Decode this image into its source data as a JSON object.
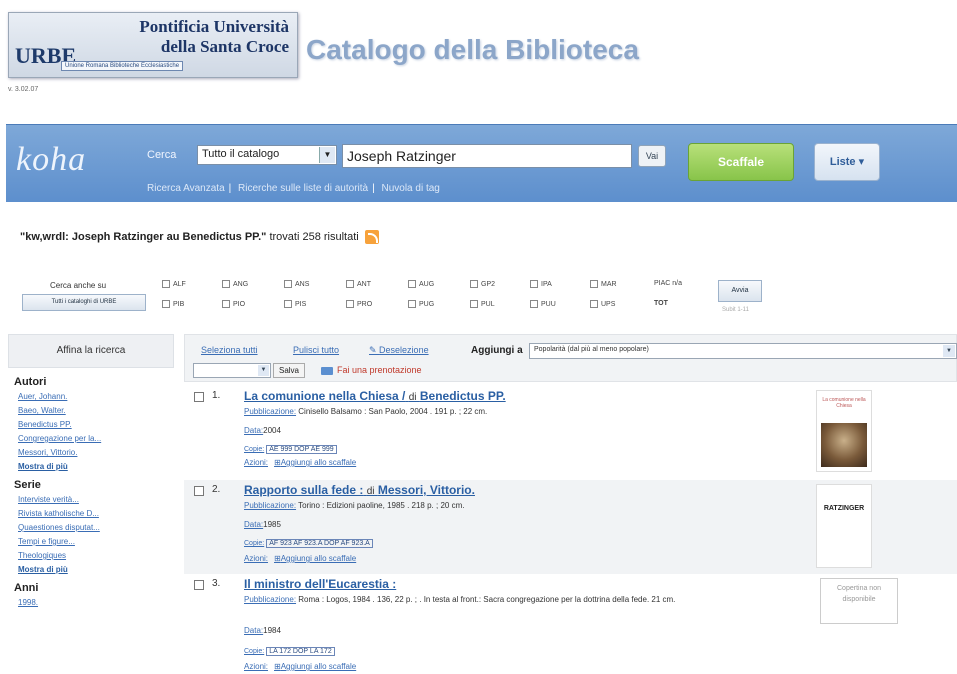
{
  "header": {
    "logo_line1": "Pontificia Università",
    "logo_line2": "della Santa Croce",
    "logo_mark": "URBE",
    "logo_sub": "Unione Romana Biblioteche Ecclesiastiche",
    "title": "Catalogo della Biblioteca",
    "version": "v. 3.02.07"
  },
  "koha": {
    "logo": "koha",
    "search_label": "Cerca",
    "scope": "Tutto il catalogo",
    "query": "Joseph Ratzinger",
    "go": "Vai",
    "shelf": "Scaffale",
    "lists": "Liste ▾",
    "sublinks": [
      "Ricerca Avanzata",
      "Ricerche sulle liste di autorità",
      "Nuvola di tag"
    ]
  },
  "results_summary": {
    "query": "\"kw,wrdl: Joseph Ratzinger au Benedictus PP.\"",
    "text": " trovati 258 risultati"
  },
  "filter": {
    "label": "Cerca anche su",
    "catalogs_button": "Tutti i cataloghi di URBE",
    "row1": [
      "ALF",
      "ANG",
      "ANS",
      "ANT",
      "AUG",
      "GP2",
      "IPA",
      "MAR"
    ],
    "row2": [
      "PIB",
      "PIO",
      "PIS",
      "PRO",
      "PUG",
      "PUL",
      "PUU",
      "UPS"
    ],
    "row1_end": "PIAC n/a",
    "row2_end": "TOT",
    "reset": "Avvia",
    "reset_sub": "Subit 1-11"
  },
  "sidebar": {
    "title": "Affina la ricerca",
    "authors_heading": "Autori",
    "authors": [
      "Auer, Johann.",
      "Baeo, Walter.",
      "Benedictus PP.",
      "Congregazione per la...",
      "Messori, Vittorio."
    ],
    "more1": "Mostra di più",
    "series_heading": "Serie",
    "series": [
      "Interviste verità...",
      "Rivista katholische D...",
      "Quaestiones disputat...",
      "Tempi e figure...",
      "Theologiques"
    ],
    "more2": "Mostra di più",
    "years_heading": "Anni",
    "years": [
      "1998."
    ]
  },
  "toolbar": {
    "select_all": "Seleziona tutti",
    "clear_all": "Pulisci tutto",
    "highlight": "Deselezione",
    "add_to": "Aggiungi a",
    "sort": "Popolarità (dal più al meno popolare)",
    "save": "Salva",
    "place_hold": "Fai una prenotazione"
  },
  "results": [
    {
      "num": "1.",
      "title": "La comunione nella Chiesa /",
      "by": "di",
      "author": "Benedictus PP.",
      "pub_label": "Pubblicazione:",
      "pub": "Cinisello Balsamo : San Paolo, 2004 . 191 p. ; 22 cm.",
      "date_label": "Data:",
      "date": "2004",
      "copies_label": "Copie:",
      "copies": "AE 999 DOP AE 999",
      "actions_label": "Azioni:",
      "add_shelf": "Aggiungi allo scaffale",
      "cover_caption": "La comunione nella Chiesa"
    },
    {
      "num": "2.",
      "title": "Rapporto sulla fede :",
      "by": "di",
      "author": "Messori, Vittorio.",
      "pub_label": "Pubblicazione:",
      "pub": "Torino : Edizioni paoline, 1985 . 218 p. ; 20 cm.",
      "date_label": "Data:",
      "date": "1985",
      "copies_label": "Copie:",
      "copies": "AF 923 AF 923.A DOP AF 923.A",
      "actions_label": "Azioni:",
      "add_shelf": "Aggiungi allo scaffale",
      "cover_caption": "RATZINGER"
    },
    {
      "num": "3.",
      "title": "Il ministro dell'Eucarestia :",
      "by": "",
      "author": "",
      "pub_label": "Pubblicazione:",
      "pub": "Roma : Logos, 1984 . 136, 22 p. ; . In testa al front.: Sacra congregazione per la dottrina della fede. 21 cm.",
      "date_label": "Data:",
      "date": "1984",
      "copies_label": "Copie:",
      "copies": "LA 172 DOP LA 172",
      "actions_label": "Azioni:",
      "add_shelf": "Aggiungi allo scaffale",
      "no_cover": "Copertina non disponibile"
    }
  ]
}
